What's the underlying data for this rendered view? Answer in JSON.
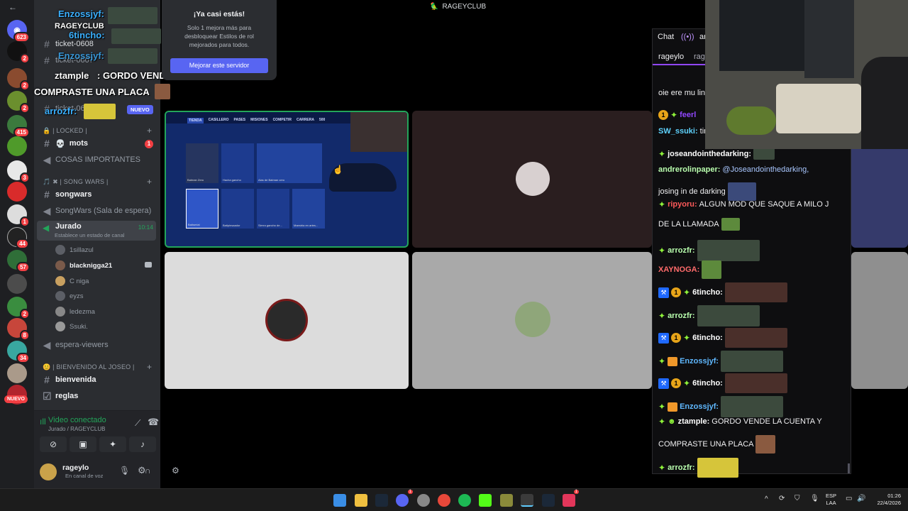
{
  "window": {
    "title": "RAGEYCLUB",
    "back": "←"
  },
  "rail": {
    "badges": [
      "623",
      "2",
      "2",
      "2",
      "2",
      "415",
      "2",
      "3",
      "2",
      "1",
      "44",
      "57",
      "2",
      "2",
      "8",
      "34",
      "2"
    ],
    "nuevo": "NUEVO"
  },
  "overlay": {
    "lines": [
      {
        "user": "Enzossjyf:",
        "color": "#3ab0ff"
      },
      {
        "user": "RAGEYCLUB",
        "color": "#ffffff"
      },
      {
        "user": "6tincho:",
        "color": "#3ab0ff"
      },
      {
        "user": "Enzossjyf:",
        "color": "#3ab0ff"
      },
      {
        "user": "ztample",
        "color": "#ffffff"
      },
      {
        "user": "arrozfr:",
        "color": "#3ab0ff"
      }
    ],
    "message_a": ": GORDO VENDE LA CUENTA Y",
    "message_b": "COMPRASTE UNA PLACA",
    "nuevo_badge": "NUEVO"
  },
  "channels": {
    "text_top": [
      "ticket-0608",
      "ticket-0607",
      "ticket-0606",
      "ticket-06..."
    ],
    "cat_locked": "🔒 | LOCKED |",
    "mots": "mots",
    "mots_badge": "1",
    "cosas": "COSAS IMPORTANTES",
    "cat_songwars": "🎵 ✖ | SONG WARS |",
    "songwars": "songwars",
    "songwars_wait": "SongWars (Sala de espera)",
    "jurado": "Jurado",
    "jurado_time": "10:14",
    "jurado_status": "Establece un estado de canal",
    "voice_users": [
      "1sillazul",
      "blacknigga21",
      "C niga",
      "eyzs",
      "ledezma",
      "Ssuki."
    ],
    "espera": "espera-viewers",
    "cat_bienvenida": "😊 | BIENVENIDO AL JOSEO |",
    "bienvenida": "bienvenida",
    "reglas": "reglas"
  },
  "voice_panel": {
    "status": "Video conectado",
    "sub": "Jurado / RAGEYCLUB"
  },
  "user_panel": {
    "name": "rageylo",
    "status": "En canal de voz"
  },
  "popup": {
    "title": "¡Ya casi estás!",
    "body": "Solo 1 mejora más para desbloquear Estilos de rol mejorados para todos.",
    "button": "Mejorar este servidor"
  },
  "game": {
    "tabs": [
      "TIENDA",
      "CASILLERO",
      "PASES",
      "MISIONES",
      "COMPETIR",
      "CARRERA",
      "500"
    ],
    "items": [
      "Batman Zero",
      "Hacha gancho",
      "Alas de Batman cero",
      "Batiserial",
      "Batipinsaador",
      "Sierra gancho de...",
      "Maestria en artes..."
    ]
  },
  "chat": {
    "tabs": [
      "Chat",
      "ar"
    ],
    "subtabs": [
      "rageylo",
      "ragi"
    ],
    "lines": [
      {
        "user": "",
        "text": "oie ere mu lin",
        "ucolor": "#efeff1"
      },
      {
        "user": "feerl",
        "text": "",
        "ucolor": "#9147ff"
      },
      {
        "user": "SW_ssuki:",
        "text": " tin",
        "ucolor": "#5fd3ff"
      },
      {
        "user": "joseandointhedarking:",
        "text": "",
        "ucolor": "#ffffff"
      },
      {
        "user": "andrerolinpaper:",
        "text": " @Joseandointhedarking,",
        "ucolor": "#b9ffae",
        "tcolor": "#a9c7ff"
      },
      {
        "user": "",
        "text": "josing in de darking",
        "ucolor": "#efeff1"
      },
      {
        "user": "ripyoru:",
        "text": " ALGUN MOD QUE SAQUE A MILO J",
        "ucolor": "#ff5a5a"
      },
      {
        "user": "",
        "text": "DE LA LLAMADA",
        "ucolor": "#efeff1"
      },
      {
        "user": "arrozfr:",
        "text": "",
        "ucolor": "#b9ffae"
      },
      {
        "user": "XAYNOGA:",
        "text": "",
        "ucolor": "#ff6b6b"
      },
      {
        "user": "6tincho:",
        "text": "",
        "ucolor": "#ffffff"
      },
      {
        "user": "arrozfr:",
        "text": "",
        "ucolor": "#b9ffae"
      },
      {
        "user": "6tincho:",
        "text": "",
        "ucolor": "#ffffff"
      },
      {
        "user": "Enzossjyf:",
        "text": "",
        "ucolor": "#5fb8ff"
      },
      {
        "user": "6tincho:",
        "text": "",
        "ucolor": "#ffffff"
      },
      {
        "user": "Enzossjyf:",
        "text": "",
        "ucolor": "#5fb8ff"
      },
      {
        "user": "ztample:",
        "text": " GORDO VENDE LA CUENTA Y",
        "ucolor": "#ffffff"
      },
      {
        "user": "",
        "text": "COMPRASTE UNA PLACA",
        "ucolor": "#efeff1"
      },
      {
        "user": "arrozfr:",
        "text": "",
        "ucolor": "#b9ffae"
      }
    ]
  },
  "taskbar": {
    "lang": "ESP",
    "lang2": "LAA",
    "time": "01:26",
    "date": "22/4/2026",
    "badge": "1",
    "badge2": "1"
  },
  "colors": {
    "accent": "#5865f2",
    "online": "#23a55a",
    "twitch": "#9147ff"
  }
}
